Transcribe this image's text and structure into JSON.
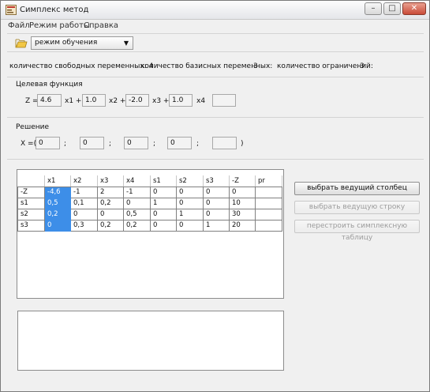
{
  "window": {
    "title": "Симплекс метод"
  },
  "menu": [
    "Файл",
    "Режим работы",
    "Справка"
  ],
  "toolbar": {
    "mode_value": "режим обучения"
  },
  "counts": {
    "free_vars_label": "количество свободных переменных: 4",
    "basic_vars_label": "количество базисных переменных:",
    "basic_vars_value": "3",
    "constraints_label": "количество ограничений:",
    "constraints_value": "3"
  },
  "objective": {
    "heading": "Целевая функция",
    "prefix": "Z =",
    "coefficients": [
      "4.6",
      "1.0",
      "-2.0",
      "1.0"
    ],
    "vars": [
      "x1 +",
      "x2 +",
      "x3 +",
      "x4"
    ],
    "extra": ""
  },
  "solution": {
    "heading": "Решение",
    "prefix": "X =(",
    "values": [
      "0",
      "0",
      "0",
      "0",
      ""
    ],
    "sep": ";",
    "suffix": ")"
  },
  "table": {
    "headers": [
      "",
      "x1",
      "x2",
      "x3",
      "x4",
      "s1",
      "s2",
      "s3",
      "-Z",
      "pr"
    ],
    "rows": [
      [
        "-Z",
        "-4,6",
        "-1",
        "2",
        "-1",
        "0",
        "0",
        "0",
        "0",
        ""
      ],
      [
        "s1",
        "0,5",
        "0,1",
        "0,2",
        "0",
        "1",
        "0",
        "0",
        "10",
        ""
      ],
      [
        "s2",
        "0,2",
        "0",
        "0",
        "0,5",
        "0",
        "1",
        "0",
        "30",
        ""
      ],
      [
        "s3",
        "0",
        "0,3",
        "0,2",
        "0,2",
        "0",
        "0",
        "1",
        "20",
        ""
      ]
    ],
    "selected_column": 1
  },
  "buttons": {
    "choose_column": "выбрать ведущий столбец",
    "choose_row": "выбрать ведущую строку",
    "rebuild": "перестроить симплексную таблицу"
  },
  "output_text": ""
}
